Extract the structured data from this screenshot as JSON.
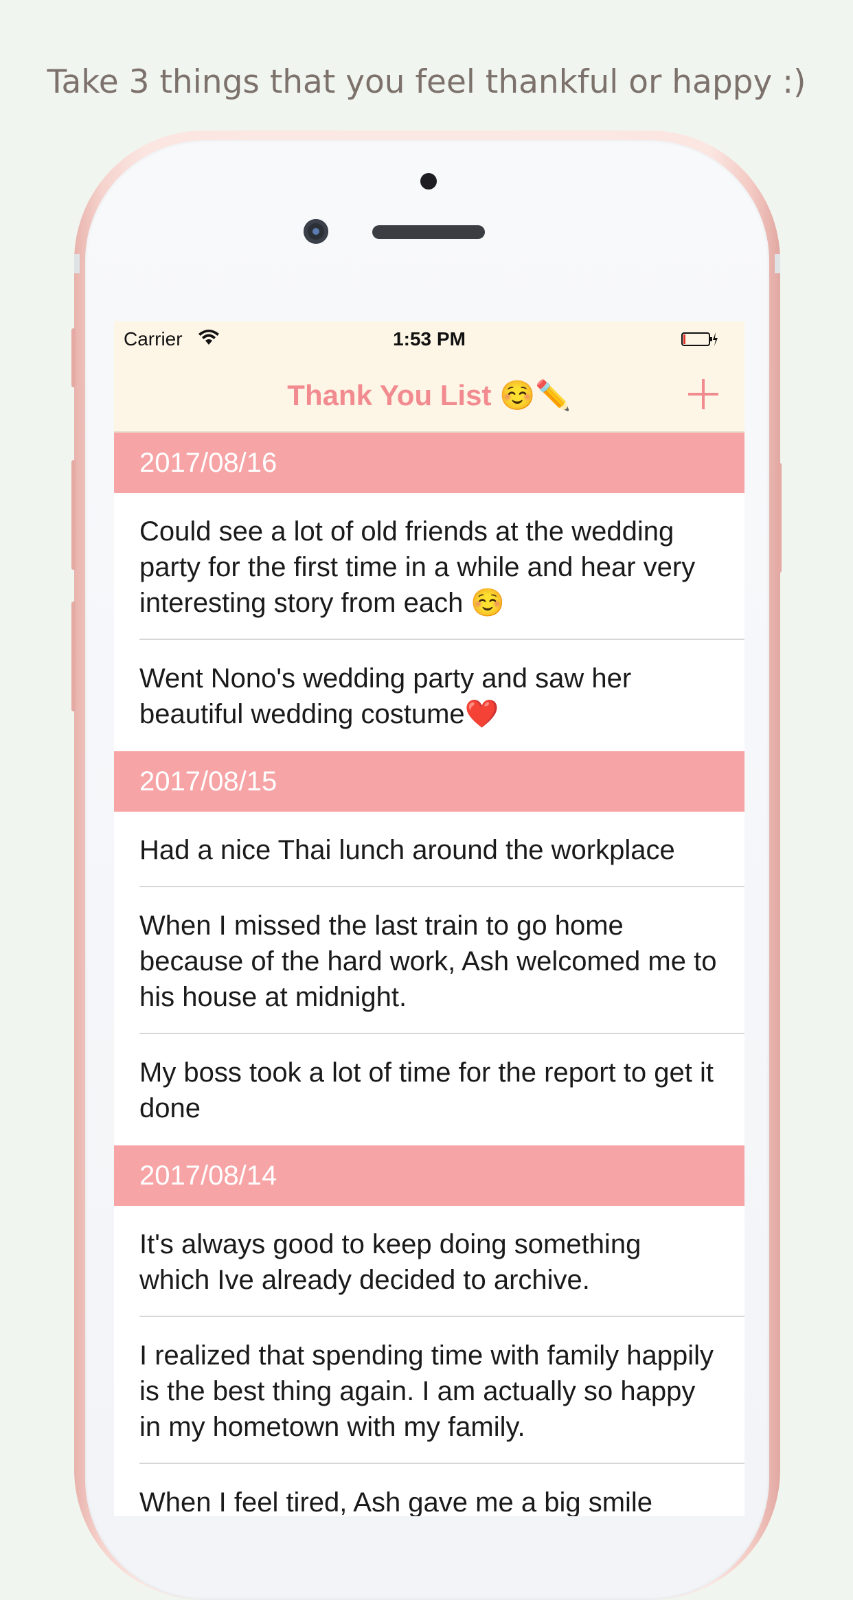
{
  "caption": "Take 3 things that you feel thankful or happy :)",
  "status_bar": {
    "carrier": "Carrier",
    "time": "1:53 PM"
  },
  "nav": {
    "title": "Thank You List ☺️✏️",
    "add_icon": "plus-icon"
  },
  "colors": {
    "accent": "#f28b90",
    "section_header": "#f7a4a6",
    "nav_background": "#fdf6e6",
    "page_background": "#f1f5ef"
  },
  "sections": [
    {
      "date": "2017/08/16",
      "items": [
        "Could see a lot of old friends at the wedding party for the first time in a while and hear very interesting story from each ☺️",
        "Went Nono's wedding party and saw her beautiful wedding costume❤️"
      ]
    },
    {
      "date": "2017/08/15",
      "items": [
        "Had a nice Thai lunch around the workplace",
        "When I missed the last train to go home because of the hard work, Ash welcomed me to his house at midnight.",
        "My boss took a lot of time for the report to get it done"
      ]
    },
    {
      "date": "2017/08/14",
      "items": [
        "It's always good to keep doing something which Ive already decided to archive.",
        "I realized that spending time with family happily is the best thing again. I am actually so happy in my hometown with my family.",
        "When I feel tired, Ash gave me a big smile"
      ]
    }
  ]
}
